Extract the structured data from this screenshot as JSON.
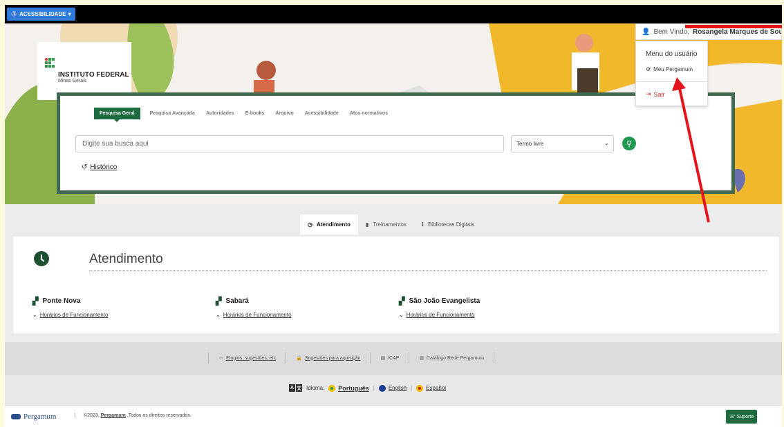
{
  "topbar": {
    "accessibility_label": "ACESSIBILIDADE"
  },
  "logo": {
    "title": "INSTITUTO FEDERAL",
    "subtitle": "Minas Gerais"
  },
  "search": {
    "tabs": [
      "Pesquisa Geral",
      "Pesquisa Avançada",
      "Autoridades",
      "E-books",
      "Arquivo",
      "Acessibilidade",
      "Atos normativos"
    ],
    "placeholder": "Digite sua busca aqui",
    "term_select": "Termo livre",
    "history_label": "Histórico"
  },
  "user": {
    "welcome": "Bem Vindo,",
    "name": "Rosangela Marques de Souza",
    "menu_title": "Menu do usuário",
    "menu_items": [
      "Meu Pergamum",
      "Sair"
    ]
  },
  "midtabs": [
    "Atendimento",
    "Treinamentos",
    "Bibliotecas Digitais"
  ],
  "attendance": {
    "title": "Atendimento",
    "locations": [
      {
        "name": "Ponte Nova",
        "link": "Horários de Funcionamento"
      },
      {
        "name": "Sabará",
        "link": "Horários de Funcionamento"
      },
      {
        "name": "São João Evangelista",
        "link": "Horários de Funcionamento"
      }
    ]
  },
  "footer_links": [
    "Elogios, sugestões, etc",
    "Sugestões para aquisição",
    "ICAP",
    "Catálogo Rede Pergamum"
  ],
  "language": {
    "label": "Idioma:",
    "options": [
      "Português",
      "English",
      "Español"
    ]
  },
  "bottom": {
    "brand": "Pergamum",
    "copyright_prefix": "©2023.",
    "copyright_brand": "Pergamum",
    "copyright_suffix": ".Todos os direitos reservados.",
    "support": "Suporte"
  },
  "colors": {
    "brand_green": "#1d6b3e",
    "panel_border": "#416a50",
    "accent_blue": "#2e7bd9",
    "annotation_red": "#e4141b"
  }
}
